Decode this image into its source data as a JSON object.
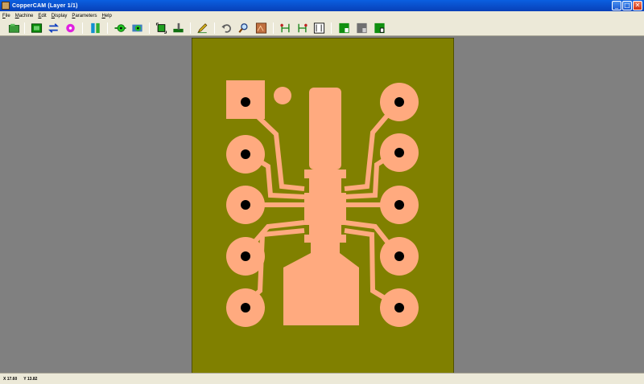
{
  "window": {
    "title": "CopperCAM    (Layer 1/1)",
    "minimize_glyph": "_",
    "maximize_glyph": "□",
    "close_glyph": "✕"
  },
  "menu": {
    "items": [
      "File",
      "Machine",
      "Edit",
      "Display",
      "Parameters",
      "Help"
    ]
  },
  "toolbar": {
    "buttons": [
      {
        "icon": "open-folder-icon"
      },
      {
        "icon": "board-view-icon"
      },
      {
        "icon": "swap-arrows-icon"
      },
      {
        "icon": "pad-magenta-icon"
      },
      {
        "icon": "layer-toggle-icon"
      },
      {
        "icon": "pad-add-icon"
      },
      {
        "icon": "pad-select-icon"
      },
      {
        "icon": "frame-contour-icon"
      },
      {
        "icon": "drill-tool-icon"
      },
      {
        "icon": "pencil-edit-icon"
      },
      {
        "icon": "undo-icon"
      },
      {
        "icon": "zoom-icon"
      },
      {
        "icon": "board-image-icon"
      },
      {
        "icon": "track-calc-1-icon"
      },
      {
        "icon": "track-calc-2-icon"
      },
      {
        "icon": "track-calc-3-icon"
      },
      {
        "icon": "mill-layer-icon"
      },
      {
        "icon": "mill-gray-icon"
      },
      {
        "icon": "mill-green-icon"
      }
    ]
  },
  "board": {
    "substrate_color": "#808000",
    "copper_color": "#ffaa7f",
    "hole_color": "#000000"
  },
  "status": {
    "x_readout": "X 17.60",
    "y_readout": "Y 13.82"
  },
  "colors": {
    "workspace": "#808080",
    "chrome": "#ece9d8",
    "titlebar": "#0a5fe0"
  }
}
